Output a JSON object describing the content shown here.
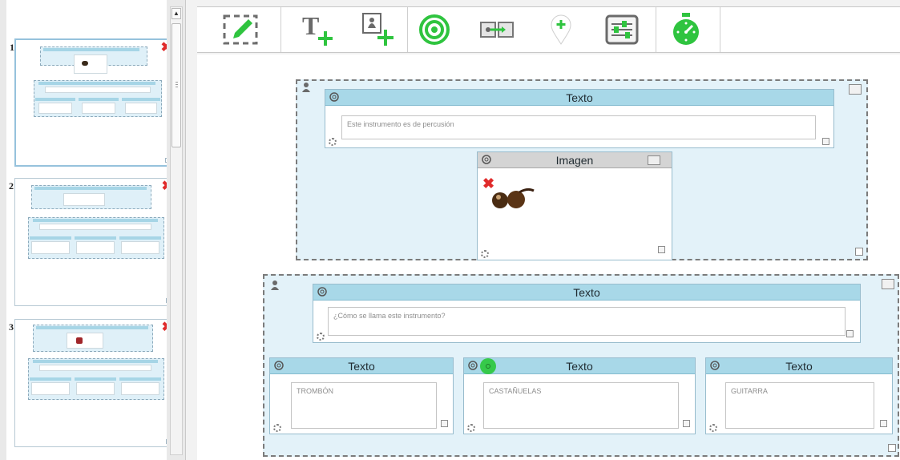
{
  "slides": [
    {
      "number": "1",
      "delete_icon": "close-x-icon",
      "active": true
    },
    {
      "number": "2",
      "delete_icon": "close-x-icon",
      "active": false
    },
    {
      "number": "3",
      "delete_icon": "close-x-icon",
      "active": false
    }
  ],
  "toolbar": {
    "tools": [
      {
        "name": "edit-slide-icon"
      },
      {
        "name": "add-text-icon"
      },
      {
        "name": "add-image-icon"
      },
      {
        "name": "target-icon"
      },
      {
        "name": "connect-icon"
      },
      {
        "name": "map-pin-icon"
      },
      {
        "name": "sliders-icon"
      },
      {
        "name": "timer-icon"
      }
    ]
  },
  "canvas": {
    "group1": {
      "text_box": {
        "header": "Texto",
        "content": "Este instrumento es de percusión"
      },
      "image_box": {
        "header": "Imagen",
        "image_icon": "castanets-image"
      }
    },
    "group2": {
      "question_box": {
        "header": "Texto",
        "content": "¿Cómo se llama este instrumento?"
      },
      "answers": [
        {
          "header": "Texto",
          "content": "TROMBÓN",
          "correct": false
        },
        {
          "header": "Texto",
          "content": "CASTAÑUELAS",
          "correct": true
        },
        {
          "header": "Texto",
          "content": "GUITARRA",
          "correct": false
        }
      ]
    }
  },
  "colors": {
    "accent_green": "#2fc43f",
    "header_blue": "#a8d8e8",
    "delete_red": "#e02b2b"
  }
}
